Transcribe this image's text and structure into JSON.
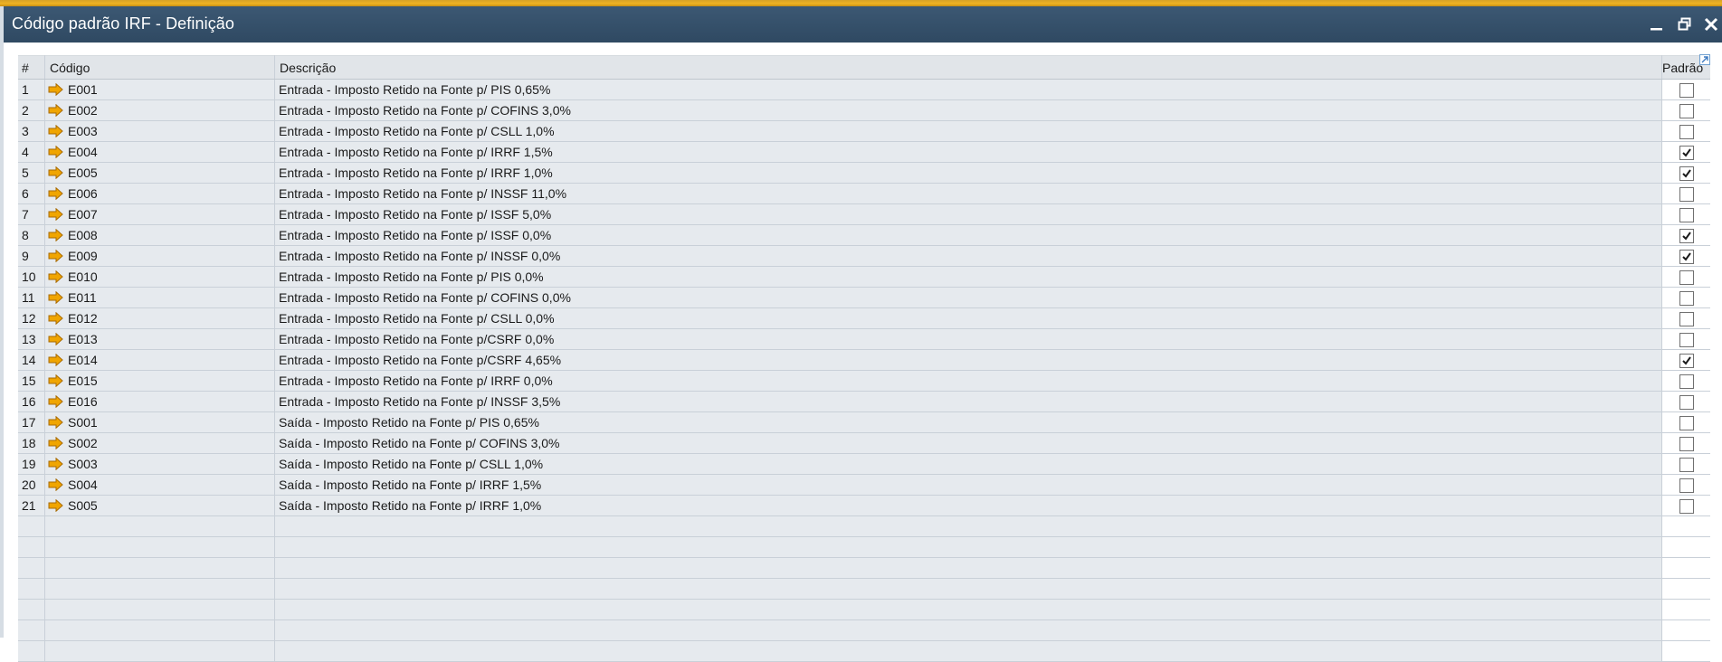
{
  "window": {
    "title": "Código padrão IRF - Definição",
    "accent_color": "#f0b323",
    "titlebar_color": "#344f69"
  },
  "grid": {
    "columns": {
      "num": "#",
      "code": "Código",
      "desc": "Descrição",
      "default": "Padrão"
    },
    "rows": [
      {
        "num": "1",
        "code": "E001",
        "desc": "Entrada - Imposto Retido na Fonte p/ PIS 0,65%",
        "default": false
      },
      {
        "num": "2",
        "code": "E002",
        "desc": "Entrada - Imposto Retido na Fonte p/ COFINS 3,0%",
        "default": false
      },
      {
        "num": "3",
        "code": "E003",
        "desc": "Entrada - Imposto Retido na Fonte p/ CSLL 1,0%",
        "default": false
      },
      {
        "num": "4",
        "code": "E004",
        "desc": "Entrada - Imposto Retido na Fonte p/ IRRF 1,5%",
        "default": true
      },
      {
        "num": "5",
        "code": "E005",
        "desc": "Entrada - Imposto Retido na Fonte p/ IRRF 1,0%",
        "default": true
      },
      {
        "num": "6",
        "code": "E006",
        "desc": "Entrada - Imposto Retido na Fonte p/ INSSF 11,0%",
        "default": false
      },
      {
        "num": "7",
        "code": "E007",
        "desc": "Entrada - Imposto Retido na Fonte p/ ISSF 5,0%",
        "default": false
      },
      {
        "num": "8",
        "code": "E008",
        "desc": "Entrada - Imposto Retido na Fonte p/ ISSF 0,0%",
        "default": true
      },
      {
        "num": "9",
        "code": "E009",
        "desc": "Entrada - Imposto Retido na Fonte p/ INSSF 0,0%",
        "default": true
      },
      {
        "num": "10",
        "code": "E010",
        "desc": "Entrada - Imposto Retido na Fonte p/ PIS 0,0%",
        "default": false
      },
      {
        "num": "11",
        "code": "E011",
        "desc": "Entrada - Imposto Retido na Fonte p/ COFINS 0,0%",
        "default": false
      },
      {
        "num": "12",
        "code": "E012",
        "desc": "Entrada - Imposto Retido na Fonte p/ CSLL 0,0%",
        "default": false
      },
      {
        "num": "13",
        "code": "E013",
        "desc": "Entrada - Imposto Retido na Fonte p/CSRF  0,0%",
        "default": false
      },
      {
        "num": "14",
        "code": "E014",
        "desc": "Entrada - Imposto Retido na Fonte p/CSRF  4,65%",
        "default": true
      },
      {
        "num": "15",
        "code": "E015",
        "desc": "Entrada - Imposto Retido na Fonte p/ IRRF 0,0%",
        "default": false
      },
      {
        "num": "16",
        "code": "E016",
        "desc": "Entrada - Imposto Retido na Fonte p/ INSSF 3,5%",
        "default": false
      },
      {
        "num": "17",
        "code": "S001",
        "desc": "Saída - Imposto Retido na Fonte p/ PIS 0,65%",
        "default": false
      },
      {
        "num": "18",
        "code": "S002",
        "desc": "Saída - Imposto Retido na Fonte p/ COFINS 3,0%",
        "default": false
      },
      {
        "num": "19",
        "code": "S003",
        "desc": "Saída - Imposto Retido na Fonte p/ CSLL 1,0%",
        "default": false
      },
      {
        "num": "20",
        "code": "S004",
        "desc": "Saída - Imposto Retido na Fonte p/ IRRF 1,5%",
        "default": false
      },
      {
        "num": "21",
        "code": "S005",
        "desc": "Saída - Imposto Retido na Fonte p/ IRRF 1,0%",
        "default": false
      }
    ],
    "empty_rows": 7,
    "link_arrow_icon": "orange-link-arrow-icon",
    "link_arrow_color": "#f0a500"
  }
}
